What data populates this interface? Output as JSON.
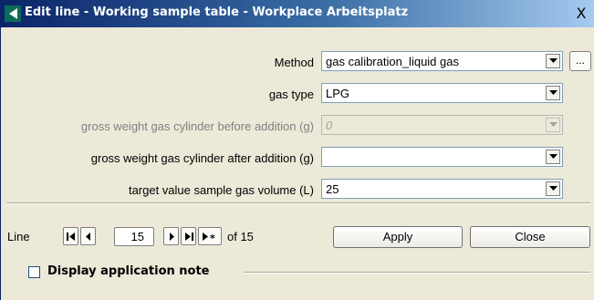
{
  "window": {
    "title": "Edit line - Working sample table - Workplace Arbeitsplatz",
    "close_glyph": "X"
  },
  "form": {
    "method_label": "Method",
    "method_value": "gas calibration_liquid gas",
    "method_more": "...",
    "gastype_label": "gas type",
    "gastype_value": "LPG",
    "before_label": "gross weight gas cylinder before addition (g)",
    "before_value": "0",
    "after_label": "gross weight gas cylinder after addition (g)",
    "after_value": "",
    "target_label": "target value sample gas volume (L)",
    "target_value": "25"
  },
  "navigation": {
    "line_label": "Line",
    "line_value": "15",
    "of_text": "of 15"
  },
  "buttons": {
    "apply": "Apply",
    "close": "Close"
  },
  "note": {
    "label": "Display application note",
    "checked": false
  },
  "icons": {
    "app": "app-logo-icon",
    "dropdown": "chevron-down-icon",
    "first": "first-record-icon",
    "prev": "previous-record-icon",
    "next": "next-record-icon",
    "last": "last-record-icon",
    "new": "new-record-icon"
  }
}
